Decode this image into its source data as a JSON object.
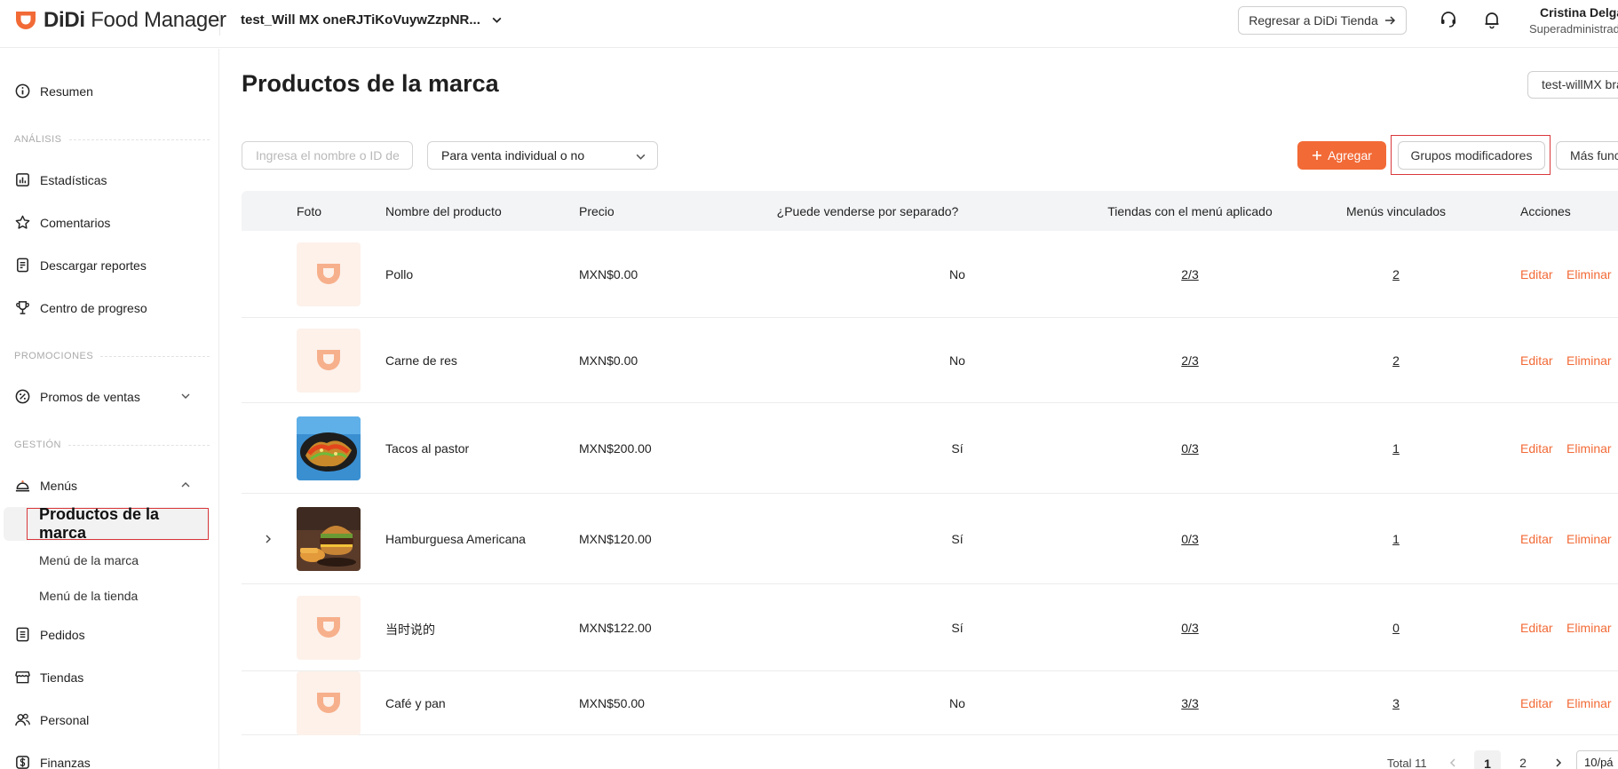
{
  "header": {
    "logo_brand": "DiDi",
    "logo_product": "Food Manager",
    "store_name": "test_Will MX oneRJTiKoVuywZzpNR...",
    "return_button": "Regresar a DiDi Tienda",
    "user_name": "Cristina Delga",
    "user_role": "Superadministrad"
  },
  "sidebar": {
    "summary": "Resumen",
    "section_analysis": "ANÁLISIS",
    "statistics": "Estadísticas",
    "comments": "Comentarios",
    "download_reports": "Descargar reportes",
    "progress_center": "Centro de progreso",
    "section_promotions": "PROMOCIONES",
    "sales_promos": "Promos de ventas",
    "section_management": "GESTIÓN",
    "menus": "Menús",
    "brand_products": "Productos de la marca",
    "brand_menu": "Menú de la marca",
    "store_menu": "Menú de la tienda",
    "orders": "Pedidos",
    "stores": "Tiendas",
    "staff": "Personal",
    "finances": "Finanzas"
  },
  "main": {
    "title": "Productos de la marca",
    "brand_selector": "test-willMX bra",
    "search_placeholder": "Ingresa el nombre o ID del",
    "filter_value": "Para venta individual o no",
    "add_button": "Agregar",
    "modifier_groups_button": "Grupos modificadores",
    "more_button": "Más funci"
  },
  "table": {
    "columns": {
      "photo": "Foto",
      "name": "Nombre del producto",
      "price": "Precio",
      "separate": "¿Puede venderse por separado?",
      "stores": "Tiendas con el menú aplicado",
      "menus": "Menús vinculados",
      "actions": "Acciones"
    },
    "edit_label": "Editar",
    "delete_label": "Eliminar",
    "rows": [
      {
        "name": "Pollo",
        "price": "MXN$0.00",
        "separate": "No",
        "stores": "2/3",
        "menus": "2",
        "photo": "placeholder"
      },
      {
        "name": "Carne de res",
        "price": "MXN$0.00",
        "separate": "No",
        "stores": "2/3",
        "menus": "2",
        "photo": "placeholder"
      },
      {
        "name": "Tacos al pastor",
        "price": "MXN$200.00",
        "separate": "Sí",
        "stores": "0/3",
        "menus": "1",
        "photo": "tacos"
      },
      {
        "name": "Hamburguesa Americana",
        "price": "MXN$120.00",
        "separate": "Sí",
        "stores": "0/3",
        "menus": "1",
        "photo": "burger"
      },
      {
        "name": "当时说的",
        "price": "MXN$122.00",
        "separate": "Sí",
        "stores": "0/3",
        "menus": "0",
        "photo": "placeholder"
      },
      {
        "name": "Café y pan",
        "price": "MXN$50.00",
        "separate": "No",
        "stores": "3/3",
        "menus": "3",
        "photo": "placeholder"
      }
    ]
  },
  "pagination": {
    "total": "Total 11",
    "current_page": "1",
    "next_page": "2",
    "page_size": "10/pá"
  },
  "colors": {
    "accent": "#f26a36",
    "highlight": "#d9383c"
  }
}
